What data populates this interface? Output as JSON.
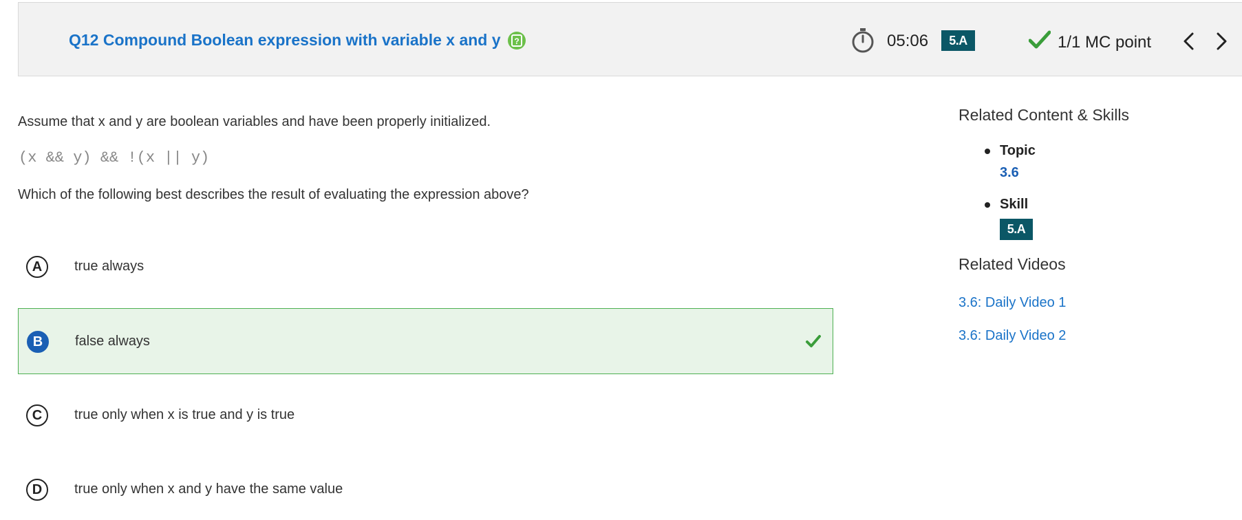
{
  "header": {
    "title": "Q12 Compound Boolean expression with variable x and y",
    "timer": "05:06",
    "skill_badge": "5.A",
    "points": "1/1 MC point",
    "help_icon": "help-icon",
    "accent_color": "#1a73c8",
    "badge_color": "#0b5766"
  },
  "question": {
    "stem": "Assume that x and y are boolean variables and have been properly initialized.",
    "code": "(x && y) && !(x || y)",
    "prompt": "Which of the following best describes the result of evaluating the expression above?"
  },
  "choices": [
    {
      "letter": "A",
      "text": "true always",
      "selected": false
    },
    {
      "letter": "B",
      "text": "false always",
      "selected": true,
      "correct": true
    },
    {
      "letter": "C",
      "text": "true only when x is true and y is true",
      "selected": false
    },
    {
      "letter": "D",
      "text": "true only when x and y have the same value",
      "selected": false
    }
  ],
  "sidebar": {
    "related_heading": "Related Content & Skills",
    "topic_label": "Topic",
    "topic_value": "3.6",
    "skill_label": "Skill",
    "skill_value": "5.A",
    "videos_heading": "Related Videos",
    "videos": [
      {
        "label": "3.6: Daily Video 1"
      },
      {
        "label": "3.6: Daily Video 2"
      }
    ]
  }
}
